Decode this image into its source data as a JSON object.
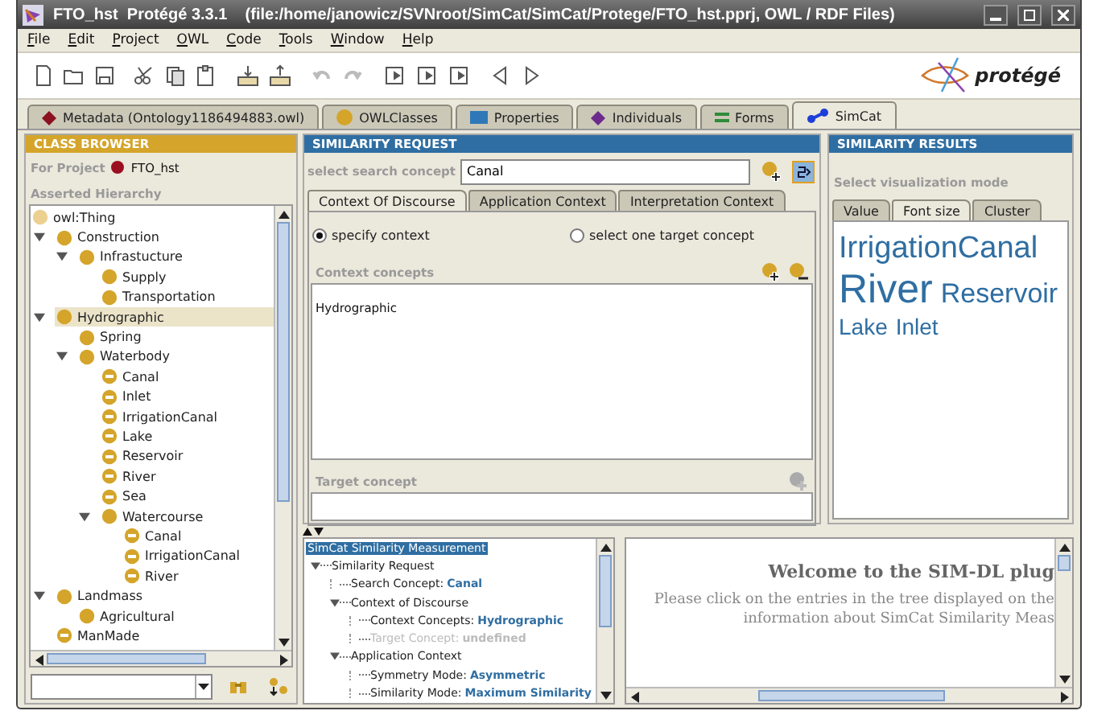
{
  "window": {
    "title": "FTO_hst  Protégé 3.3.1    (file:/home/janowicz/SVNroot/SimCat/SimCat/Protege/FTO_hst.pprj, OWL / RDF Files)"
  },
  "menu": [
    "File",
    "Edit",
    "Project",
    "OWL",
    "Code",
    "Tools",
    "Window",
    "Help"
  ],
  "logo": {
    "text": "protégé"
  },
  "tabs": [
    {
      "label": "Metadata (Ontology1186494883.owl)",
      "selected": false
    },
    {
      "label": "OWLClasses",
      "selected": false
    },
    {
      "label": "Properties",
      "selected": false
    },
    {
      "label": "Individuals",
      "selected": false
    },
    {
      "label": "Forms",
      "selected": false
    },
    {
      "label": "SimCat",
      "selected": true
    }
  ],
  "class_browser": {
    "title": "CLASS BROWSER",
    "project_label": "For Project",
    "project": "FTO_hst",
    "hierarchy_label": "Asserted Hierarchy",
    "root": {
      "label": "owl:Thing"
    },
    "tree": [
      {
        "label": "Construction",
        "kind": "class",
        "selected": false,
        "expanded": true,
        "children": [
          {
            "label": "Infrastucture",
            "kind": "class",
            "selected": false,
            "expanded": true,
            "children": [
              {
                "label": "Supply",
                "kind": "class",
                "selected": false
              },
              {
                "label": "Transportation",
                "kind": "class",
                "selected": false
              }
            ]
          }
        ]
      },
      {
        "label": "Hydrographic",
        "kind": "class",
        "selected": true,
        "expanded": true,
        "children": [
          {
            "label": "Spring",
            "kind": "class",
            "selected": false
          },
          {
            "label": "Waterbody",
            "kind": "class",
            "selected": false,
            "expanded": true,
            "children": [
              {
                "label": "Canal",
                "kind": "defined",
                "selected": false
              },
              {
                "label": "Inlet",
                "kind": "defined",
                "selected": false
              },
              {
                "label": "IrrigationCanal",
                "kind": "defined",
                "selected": false
              },
              {
                "label": "Lake",
                "kind": "defined",
                "selected": false
              },
              {
                "label": "Reservoir",
                "kind": "defined",
                "selected": false
              },
              {
                "label": "River",
                "kind": "defined",
                "selected": false
              },
              {
                "label": "Sea",
                "kind": "defined",
                "selected": false
              },
              {
                "label": "Watercourse",
                "kind": "class",
                "selected": false,
                "expanded": true,
                "children": [
                  {
                    "label": "Canal",
                    "kind": "defined",
                    "selected": false
                  },
                  {
                    "label": "IrrigationCanal",
                    "kind": "defined",
                    "selected": false
                  },
                  {
                    "label": "River",
                    "kind": "defined",
                    "selected": false
                  }
                ]
              }
            ]
          }
        ]
      },
      {
        "label": "Landmass",
        "kind": "class",
        "selected": false,
        "expanded": true,
        "children": [
          {
            "label": "Agricultural",
            "kind": "class",
            "selected": false
          }
        ]
      },
      {
        "label": "ManMade",
        "kind": "defined",
        "selected": false
      }
    ]
  },
  "similarity_request": {
    "title": "SIMILARITY REQUEST",
    "search_label": "select search concept",
    "search_value": "Canal",
    "tabs": [
      {
        "label": "Context Of Discourse",
        "selected": true
      },
      {
        "label": "Application Context",
        "selected": false
      },
      {
        "label": "Interpretation Context",
        "selected": false
      }
    ],
    "radios": [
      {
        "label": "specify context",
        "selected": true
      },
      {
        "label": "select one target concept",
        "selected": false
      }
    ],
    "context_label": "Context concepts",
    "context_items": [
      "Hydrographic"
    ],
    "target_label": "Target concept"
  },
  "results": {
    "title": "SIMILARITY RESULTS",
    "mode_label": "Select visualization mode",
    "tabs": [
      {
        "label": "Value",
        "selected": false
      },
      {
        "label": "Font size",
        "selected": true
      },
      {
        "label": "Cluster",
        "selected": false
      }
    ],
    "terms": [
      "IrrigationCanal",
      "River",
      "Reservoir",
      "Lake",
      "Inlet"
    ]
  },
  "measurement_tree": {
    "root": {
      "label": "SimCat Similarity Measurement",
      "selected": true
    },
    "nodes": [
      {
        "label": "Similarity Request",
        "expanded": true,
        "children": [
          {
            "label": "Search Concept:",
            "value": "Canal",
            "disabled": false
          },
          {
            "label": "Context of Discourse",
            "expanded": true,
            "children": [
              {
                "label": "Context Concepts:",
                "value": "Hydrographic",
                "disabled": false
              },
              {
                "label": "Target Concept:",
                "value": "undefined",
                "disabled": true
              }
            ]
          },
          {
            "label": "Application Context",
            "expanded": true,
            "children": [
              {
                "label": "Symmetry Mode:",
                "value": "Asymmetric",
                "disabled": false
              },
              {
                "label": "Similarity Mode:",
                "value": "Maximum Similarity",
                "disabled": false
              }
            ]
          }
        ]
      }
    ]
  },
  "welcome": {
    "heading": "Welcome to the SIM-DL plug",
    "lines": [
      "Please click on the entries in the tree displayed on the",
      "information about SimCat Similarity Meas"
    ]
  }
}
